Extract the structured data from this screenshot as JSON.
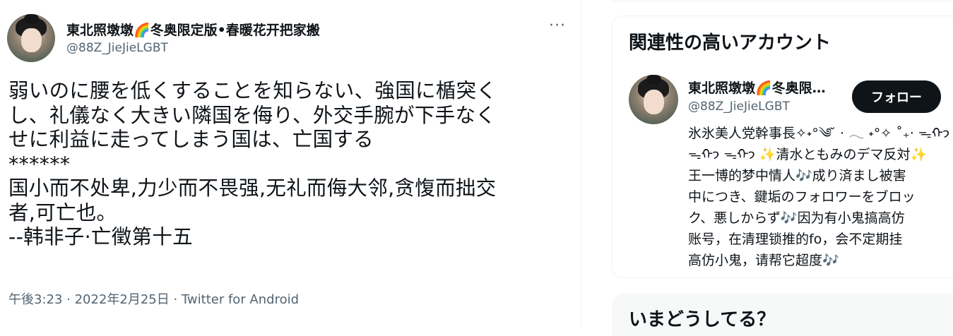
{
  "tweet": {
    "display_name": "東北照墩墩🌈冬奥限定版•春暖花开把家搬",
    "handle": "@88Z_JieJieLGBT",
    "more_label": "···",
    "text_lines": [
      "弱いのに腰を低くすることを知らない、強国に楯突く",
      "し、礼儀なく大きい隣国を侮り、外交手腕が下手なく",
      "せに利益に走ってしまう国は、亡国する",
      "******",
      "国小而不处卑,力少而不畏强,无礼而侮大邻,贪愎而拙交",
      "者,可亡也。",
      "--韩非子·亡徵第十五"
    ],
    "meta": "午後3:23 · 2022年2月25日 · Twitter for Android"
  },
  "related": {
    "title": "関連性の高いアカウント",
    "account": {
      "display_name": "東北照墩墩🌈冬奥限…",
      "handle": "@88Z_JieJieLGBT",
      "follow_label": "フォロー",
      "bio_lines": [
        "氷氷美人党幹事長✧˖°༄ ̆  ‧ 𓂃 ˖°✧ ˚₊‧ ᯓᡣ𐭩",
        "ᯓᡣ𐭩 ᯓᡣ𐭩 ✨清水ともみのデマ反対✨",
        "王一博的梦中情人🎶成り済まし被害",
        "中につき、鍵垢のフォロワーをブロッ",
        "ク、悪しからず🎶因为有小鬼搞高仿",
        "账号，在清理锁推的fo，会不定期挂",
        "高仿小鬼，请帮它超度🎶"
      ]
    }
  },
  "trending": {
    "title": "いまどうしてる？"
  },
  "icons": {
    "tweet_avatar": "avatar-photo",
    "related_avatar": "avatar-photo",
    "more": "more-dots-icon"
  },
  "colors": {
    "text": "#0f1419",
    "secondary": "#536471",
    "follow_bg": "#0f1419",
    "panel_bg": "#f7f9f9"
  }
}
